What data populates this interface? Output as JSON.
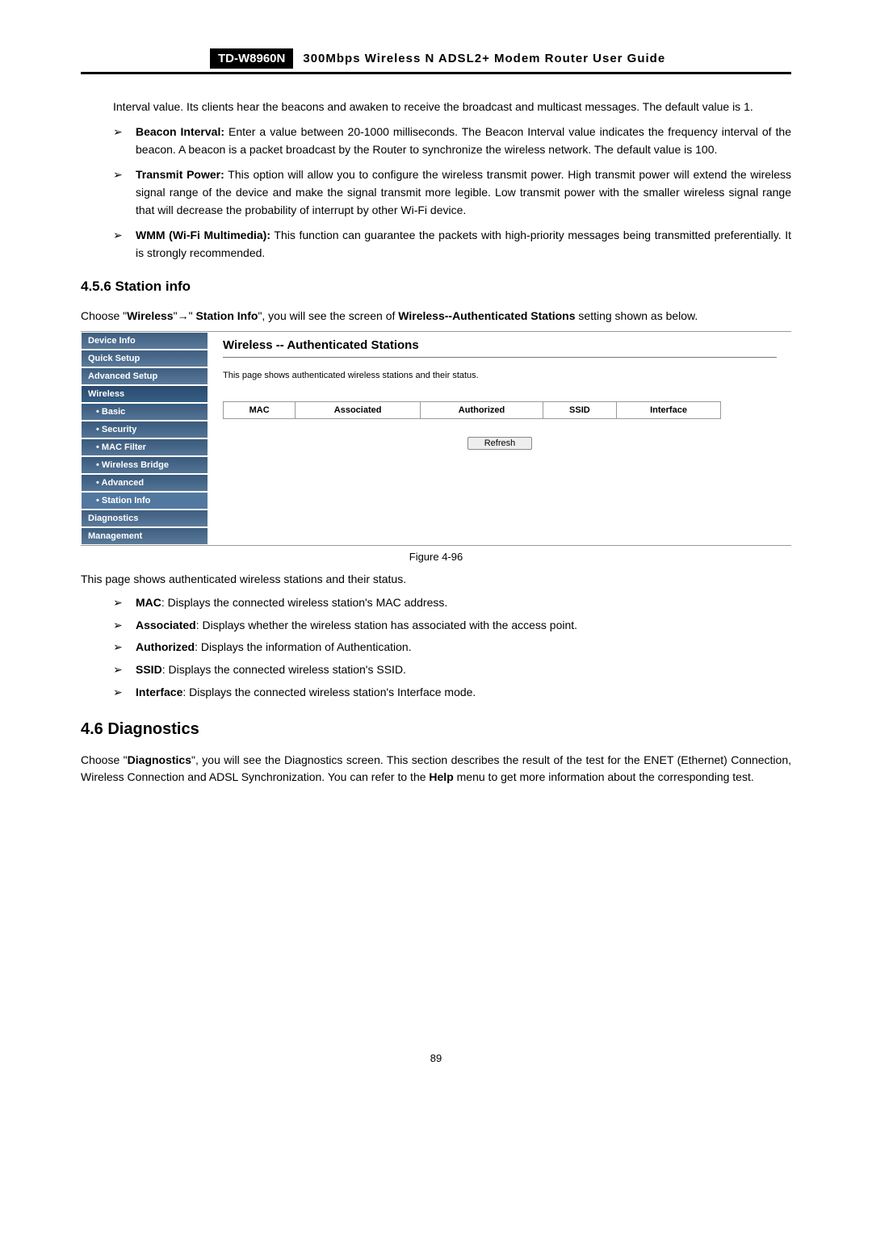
{
  "header": {
    "model": "TD-W8960N",
    "title": "300Mbps  Wireless  N  ADSL2+  Modem  Router  User  Guide"
  },
  "intro_text": "Interval value. Its clients hear the beacons and awaken to receive the broadcast and multicast messages. The default value is 1.",
  "bullets1": {
    "b1_bold": "Beacon Interval:",
    "b1_text": " Enter a value between 20-1000 milliseconds. The Beacon Interval value indicates the frequency interval of the beacon. A beacon is a packet broadcast by the Router to synchronize the wireless network. The default value is 100.",
    "b2_bold": "Transmit Power:",
    "b2_text": " This option will allow you to configure the wireless transmit power. High transmit power will extend the wireless signal range of the device and make the signal transmit more legible. Low transmit power with the smaller wireless signal range that will decrease the probability of interrupt by other Wi-Fi device.",
    "b3_bold": "WMM (Wi-Fi Multimedia):",
    "b3_text": " This function can guarantee the packets with high-priority messages being transmitted preferentially. It is strongly recommended."
  },
  "section_456": "4.5.6   Station info",
  "choose_text": {
    "pre": "Choose \"",
    "wireless": "Wireless",
    "arrow": "\"→\" ",
    "station": "Station Info",
    "mid": "\", you will see the screen of ",
    "auth": "Wireless--Authenticated Stations",
    "post": " setting shown as below."
  },
  "sidebar": {
    "device_info": "Device Info",
    "quick_setup": "Quick Setup",
    "advanced_setup": "Advanced Setup",
    "wireless": "Wireless",
    "basic": "• Basic",
    "security": "• Security",
    "mac_filter": "• MAC Filter",
    "wireless_bridge": "• Wireless Bridge",
    "advanced": "• Advanced",
    "station_info": "• Station Info",
    "diagnostics": "Diagnostics",
    "management": "Management"
  },
  "panel": {
    "title": "Wireless -- Authenticated Stations",
    "desc": "This page shows authenticated wireless stations and their status.",
    "cols": {
      "mac": "MAC",
      "associated": "Associated",
      "authorized": "Authorized",
      "ssid": "SSID",
      "interface": "Interface"
    },
    "refresh": "Refresh"
  },
  "figure_caption": "Figure 4-96",
  "page_shows_text": "This page shows authenticated wireless stations and their status.",
  "bullets2": {
    "mac_bold": "MAC",
    "mac_text": ": Displays the connected wireless station's MAC address.",
    "assoc_bold": "Associated",
    "assoc_text": ": Displays whether the wireless station has associated with the access point.",
    "auth_bold": "Authorized",
    "auth_text": ": Displays the information of Authentication.",
    "ssid_bold": "SSID",
    "ssid_text": ": Displays the connected wireless station's SSID.",
    "iface_bold": "Interface",
    "iface_text": ": Displays the connected wireless station's Interface mode."
  },
  "section_46": "4.6  Diagnostics",
  "diagnostics_text": {
    "pre": "Choose \"",
    "bold1": "Diagnostics",
    "mid": "\", you will see the Diagnostics screen. This section describes the result of the test for the ENET (Ethernet) Connection, Wireless Connection and ADSL Synchronization. You can refer to the ",
    "bold2": "Help",
    "post": " menu to get more information about the corresponding test."
  },
  "page_number": "89"
}
